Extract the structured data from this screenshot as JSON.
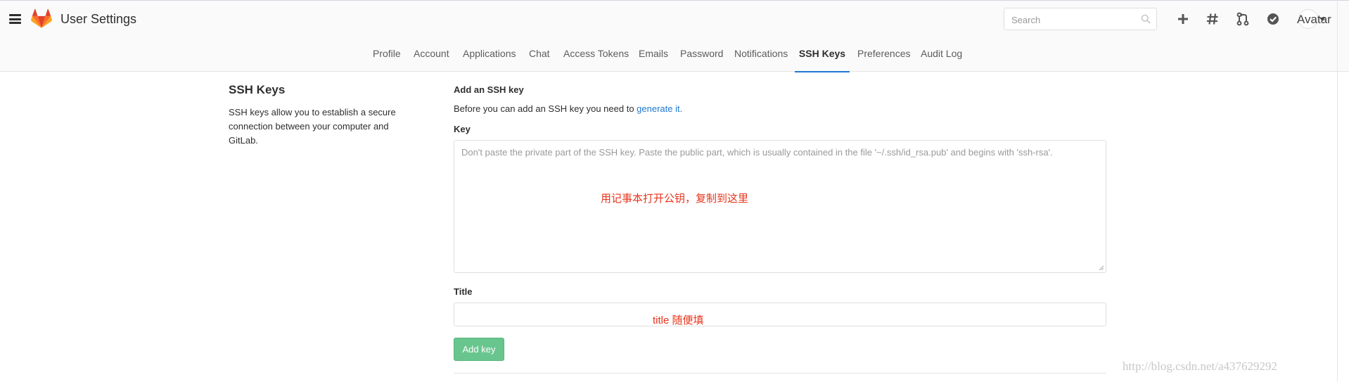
{
  "header": {
    "title": "User Settings",
    "search_placeholder": "Search",
    "avatar_label": "Avatar",
    "icons": [
      "menu-icon",
      "gitlab-logo",
      "search-icon",
      "plus-icon",
      "hash-icon",
      "merge-request-icon",
      "todo-check-icon"
    ]
  },
  "tabs": [
    {
      "label": "Profile"
    },
    {
      "label": "Account"
    },
    {
      "label": "Applications"
    },
    {
      "label": "Chat"
    },
    {
      "label": "Access Tokens"
    },
    {
      "label": "Emails"
    },
    {
      "label": "Password"
    },
    {
      "label": "Notifications"
    },
    {
      "label": "SSH Keys",
      "active": true
    },
    {
      "label": "Preferences"
    },
    {
      "label": "Audit Log"
    }
  ],
  "section": {
    "title": "SSH Keys",
    "description": "SSH keys allow you to establish a secure connection between your computer and GitLab."
  },
  "form": {
    "heading": "Add an SSH key",
    "intro_text": "Before you can add an SSH key you need to ",
    "intro_link": "generate it.",
    "key_label": "Key",
    "key_placeholder": "Don't paste the private part of the SSH key. Paste the public part, which is usually contained in the file '~/.ssh/id_rsa.pub' and begins with 'ssh-rsa'.",
    "title_label": "Title",
    "title_value": "",
    "submit_label": "Add key"
  },
  "annotations": {
    "key_note": "用记事本打开公钥，复制到这里",
    "title_note": "title 随便填"
  },
  "watermark": "http://blog.csdn.net/a437629292",
  "colors": {
    "accent": "#1f78d1",
    "button": "#69c58e",
    "annotation": "#e8341c",
    "logo": [
      "#e24329",
      "#fc6d26",
      "#fca326"
    ]
  }
}
